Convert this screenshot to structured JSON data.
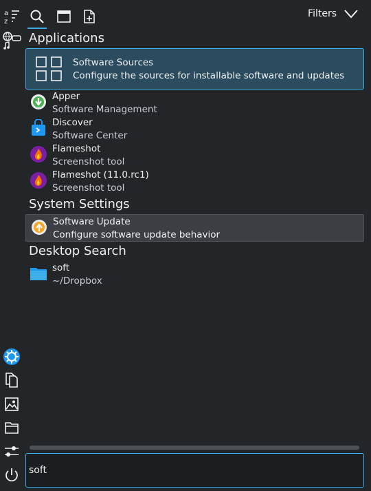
{
  "filters_label": "Filters",
  "search": {
    "value": "soft"
  },
  "sections": {
    "applications": "Applications",
    "system_settings": "System Settings",
    "desktop_search": "Desktop Search"
  },
  "results": {
    "software_sources": {
      "title": "Software Sources",
      "sub": "Configure the sources for installable software and updates"
    },
    "apper": {
      "title": "Apper",
      "sub": "Software Management"
    },
    "discover": {
      "title": "Discover",
      "sub": "Software Center"
    },
    "flameshot": {
      "title": "Flameshot",
      "sub": "Screenshot tool"
    },
    "flameshot_rc": {
      "title": "Flameshot (11.0.rc1)",
      "sub": "Screenshot tool"
    },
    "software_update": {
      "title": "Software Update",
      "sub": "Configure software update behavior"
    },
    "soft_file": {
      "title": "soft",
      "sub": "~/Dropbox"
    }
  },
  "colors": {
    "accent": "#3daee9",
    "background": "#232629"
  }
}
